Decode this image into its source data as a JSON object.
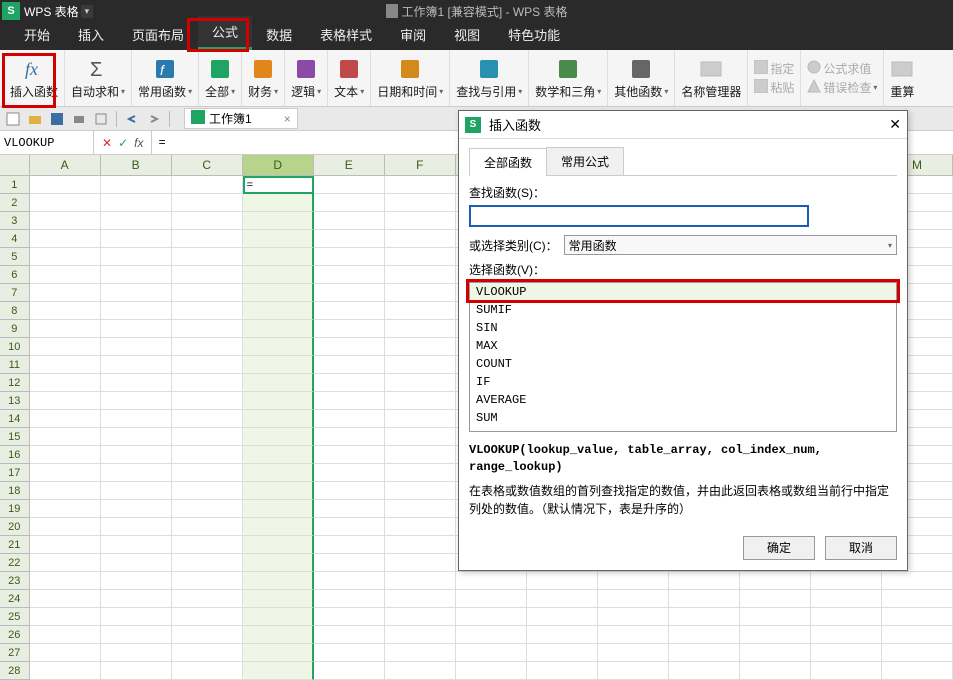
{
  "app": {
    "name": "WPS 表格",
    "center_title": "工作簿1 [兼容模式] - WPS 表格"
  },
  "main_tabs": [
    "开始",
    "插入",
    "页面布局",
    "公式",
    "数据",
    "表格样式",
    "审阅",
    "视图",
    "特色功能"
  ],
  "main_tab_active": 3,
  "ribbon": {
    "insert_fn": "插入函数",
    "autosum": "自动求和",
    "common": "常用函数",
    "all": "全部",
    "finance": "财务",
    "logic": "逻辑",
    "text": "文本",
    "datetime": "日期和时间",
    "lookup": "查找与引用",
    "mathtrig": "数学和三角",
    "other": "其他函数",
    "name_mgr": "名称管理器",
    "name_set": "指定",
    "paste": "粘贴",
    "formula_eval": "公式求值",
    "error_check": "错误检查",
    "recalc": "重算"
  },
  "qat": {
    "workbook_tab": "工作簿1"
  },
  "fxbar": {
    "namebox": "VLOOKUP",
    "formula": "="
  },
  "columns": [
    "A",
    "B",
    "C",
    "D",
    "E",
    "F",
    "",
    "",
    "",
    "",
    "",
    "M"
  ],
  "active_col": "D",
  "active_row": 1,
  "cell_d1": "=",
  "row_count": 28,
  "dialog": {
    "title": "插入函数",
    "tab_all": "全部函数",
    "tab_common": "常用公式",
    "search_label": "查找函数(S)：",
    "search_value": "",
    "cat_label": "或选择类别(C)：",
    "cat_value": "常用函数",
    "list_label": "选择函数(V)：",
    "functions": [
      "VLOOKUP",
      "SUMIF",
      "SIN",
      "MAX",
      "COUNT",
      "IF",
      "AVERAGE",
      "SUM"
    ],
    "selected_fn": "VLOOKUP",
    "signature": "VLOOKUP(lookup_value, table_array, col_index_num, range_lookup)",
    "description": "在表格或数值数组的首列查找指定的数值，并由此返回表格或数组当前行中指定列处的数值。（默认情况下，表是升序的）",
    "ok": "确定",
    "cancel": "取消"
  }
}
